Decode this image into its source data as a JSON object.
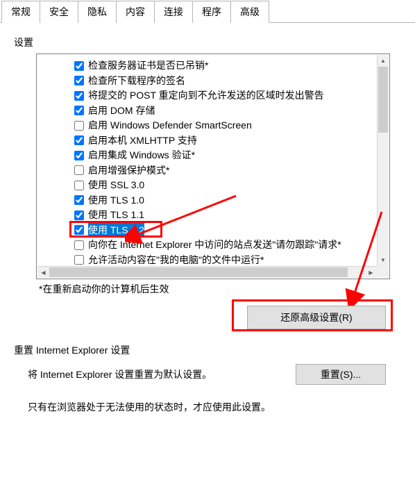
{
  "tabs": {
    "items": [
      "常规",
      "安全",
      "隐私",
      "内容",
      "连接",
      "程序",
      "高级"
    ],
    "active": 6
  },
  "settings": {
    "label": "设置",
    "items": [
      {
        "checked": true,
        "label": "检查服务器证书是否已吊销*"
      },
      {
        "checked": true,
        "label": "检查所下载程序的签名"
      },
      {
        "checked": true,
        "label": "将提交的 POST 重定向到不允许发送的区域时发出警告"
      },
      {
        "checked": true,
        "label": "启用 DOM 存储"
      },
      {
        "checked": false,
        "label": "启用 Windows Defender SmartScreen"
      },
      {
        "checked": true,
        "label": "启用本机 XMLHTTP 支持"
      },
      {
        "checked": true,
        "label": "启用集成 Windows 验证*"
      },
      {
        "checked": false,
        "label": "启用增强保护模式*"
      },
      {
        "checked": false,
        "label": "使用 SSL 3.0"
      },
      {
        "checked": true,
        "label": "使用 TLS 1.0"
      },
      {
        "checked": true,
        "label": "使用 TLS 1.1"
      },
      {
        "checked": true,
        "label": "使用 TLS 1.2",
        "selected": true
      },
      {
        "checked": false,
        "label": "向你在 Internet Explorer 中访问的站点发送\"请勿跟踪\"请求*"
      },
      {
        "checked": false,
        "label": "允许活动内容在\"我的电脑\"的文件中运行*"
      }
    ],
    "note": "*在重新启动你的计算机后生效"
  },
  "buttons": {
    "restore": "还原高级设置(R)",
    "reset": "重置(S)..."
  },
  "reset_section": {
    "title": "重置 Internet Explorer 设置",
    "desc": "将 Internet Explorer 设置重置为默认设置。",
    "note": "只有在浏览器处于无法使用的状态时，才应使用此设置。"
  }
}
